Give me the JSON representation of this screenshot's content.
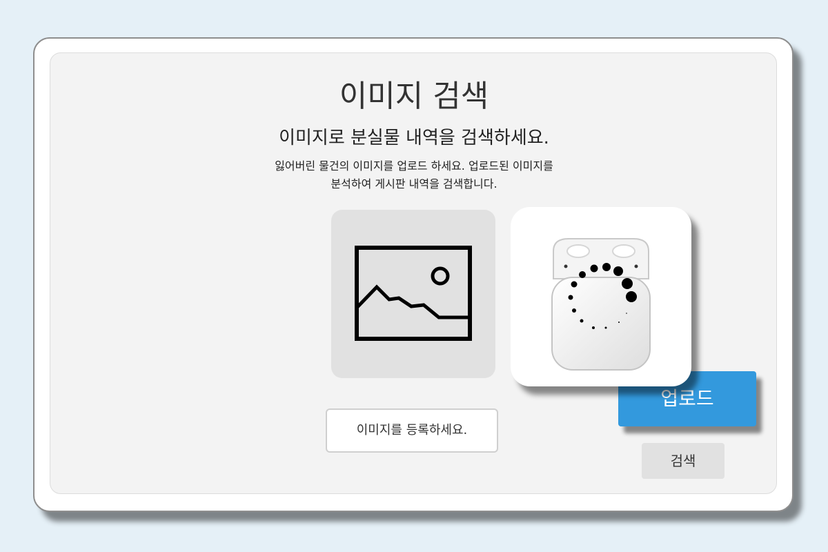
{
  "page": {
    "title": "이미지 검색",
    "subtitle": "이미지로 분실물 내역을 검색하세요.",
    "description_lines": [
      "잃어버린 물건의 이미지를 업로드 하세요. 업로드된 이미지를",
      "분석하여 게시판 내역을 검색합니다."
    ]
  },
  "buttons": {
    "register_label": "이미지를 등록하세요.",
    "upload_label": "업로드",
    "search_label": "검색"
  },
  "icons": {
    "placeholder": "image-placeholder-icon",
    "preview": "airpods-case-image",
    "loading": "loading-spinner-icon"
  },
  "colors": {
    "background": "#e5f0f7",
    "panel": "#f3f3f3",
    "upload_button": "#3399dd",
    "search_button": "#e1e1e1"
  }
}
